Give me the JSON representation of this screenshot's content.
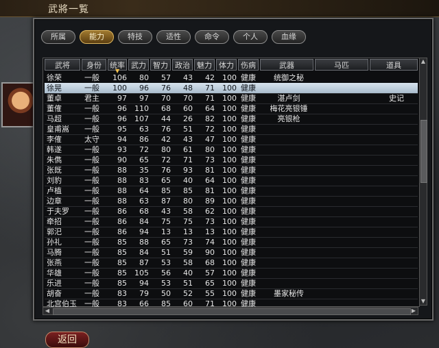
{
  "window_title": "武將一覧",
  "tabs": [
    "所属",
    "能力",
    "特技",
    "适性",
    "命令",
    "个人",
    "血缘"
  ],
  "active_tab": 1,
  "columns": [
    "武将",
    "身份",
    "统率",
    "武力",
    "智力",
    "政治",
    "魅力",
    "体力",
    "伤病",
    "武器",
    "马匹",
    "道具"
  ],
  "sorted_column": 2,
  "selected_row": 1,
  "rows": [
    {
      "name": "徐荣",
      "rank": "一般",
      "lead": 106,
      "war": 80,
      "int": 57,
      "pol": 43,
      "cha": 42,
      "hp": 100,
      "cond": "健康",
      "weapon": "统御之秘",
      "horse": "",
      "item": ""
    },
    {
      "name": "徐晃",
      "rank": "一般",
      "lead": 100,
      "war": 96,
      "int": 76,
      "pol": 48,
      "cha": 71,
      "hp": 100,
      "cond": "健康",
      "weapon": "",
      "horse": "",
      "item": ""
    },
    {
      "name": "董卓",
      "rank": "君主",
      "lead": 97,
      "war": 97,
      "int": 70,
      "pol": 70,
      "cha": 71,
      "hp": 100,
      "cond": "健康",
      "weapon": "湛卢剑",
      "horse": "",
      "item": "史记"
    },
    {
      "name": "董傕",
      "rank": "一般",
      "lead": 96,
      "war": 110,
      "int": 68,
      "pol": 60,
      "cha": 64,
      "hp": 100,
      "cond": "健康",
      "weapon": "梅花亮银锤",
      "horse": "",
      "item": ""
    },
    {
      "name": "马超",
      "rank": "一般",
      "lead": 96,
      "war": 107,
      "int": 44,
      "pol": 26,
      "cha": 82,
      "hp": 100,
      "cond": "健康",
      "weapon": "亮银枪",
      "horse": "",
      "item": ""
    },
    {
      "name": "皇甫嵩",
      "rank": "一般",
      "lead": 95,
      "war": 63,
      "int": 76,
      "pol": 51,
      "cha": 72,
      "hp": 100,
      "cond": "健康",
      "weapon": "",
      "horse": "",
      "item": ""
    },
    {
      "name": "李傕",
      "rank": "太守",
      "lead": 94,
      "war": 86,
      "int": 42,
      "pol": 43,
      "cha": 47,
      "hp": 100,
      "cond": "健康",
      "weapon": "",
      "horse": "",
      "item": ""
    },
    {
      "name": "韩遂",
      "rank": "一般",
      "lead": 93,
      "war": 72,
      "int": 80,
      "pol": 61,
      "cha": 80,
      "hp": 100,
      "cond": "健康",
      "weapon": "",
      "horse": "",
      "item": ""
    },
    {
      "name": "朱儁",
      "rank": "一般",
      "lead": 90,
      "war": 65,
      "int": 72,
      "pol": 71,
      "cha": 73,
      "hp": 100,
      "cond": "健康",
      "weapon": "",
      "horse": "",
      "item": ""
    },
    {
      "name": "张既",
      "rank": "一般",
      "lead": 88,
      "war": 35,
      "int": 76,
      "pol": 93,
      "cha": 81,
      "hp": 100,
      "cond": "健康",
      "weapon": "",
      "horse": "",
      "item": ""
    },
    {
      "name": "刘豹",
      "rank": "一般",
      "lead": 88,
      "war": 83,
      "int": 65,
      "pol": 40,
      "cha": 64,
      "hp": 100,
      "cond": "健康",
      "weapon": "",
      "horse": "",
      "item": ""
    },
    {
      "name": "卢植",
      "rank": "一般",
      "lead": 88,
      "war": 64,
      "int": 85,
      "pol": 85,
      "cha": 81,
      "hp": 100,
      "cond": "健康",
      "weapon": "",
      "horse": "",
      "item": ""
    },
    {
      "name": "边章",
      "rank": "一般",
      "lead": 88,
      "war": 63,
      "int": 87,
      "pol": 80,
      "cha": 89,
      "hp": 100,
      "cond": "健康",
      "weapon": "",
      "horse": "",
      "item": ""
    },
    {
      "name": "于夫罗",
      "rank": "一般",
      "lead": 86,
      "war": 68,
      "int": 43,
      "pol": 58,
      "cha": 62,
      "hp": 100,
      "cond": "健康",
      "weapon": "",
      "horse": "",
      "item": ""
    },
    {
      "name": "牵招",
      "rank": "一般",
      "lead": 86,
      "war": 84,
      "int": 75,
      "pol": 75,
      "cha": 73,
      "hp": 100,
      "cond": "健康",
      "weapon": "",
      "horse": "",
      "item": ""
    },
    {
      "name": "郭汜",
      "rank": "一般",
      "lead": 86,
      "war": 94,
      "int": 13,
      "pol": 13,
      "cha": 13,
      "hp": 100,
      "cond": "健康",
      "weapon": "",
      "horse": "",
      "item": ""
    },
    {
      "name": "孙礼",
      "rank": "一般",
      "lead": 85,
      "war": 88,
      "int": 65,
      "pol": 73,
      "cha": 74,
      "hp": 100,
      "cond": "健康",
      "weapon": "",
      "horse": "",
      "item": ""
    },
    {
      "name": "马腾",
      "rank": "一般",
      "lead": 85,
      "war": 84,
      "int": 51,
      "pol": 59,
      "cha": 90,
      "hp": 100,
      "cond": "健康",
      "weapon": "",
      "horse": "",
      "item": ""
    },
    {
      "name": "张燕",
      "rank": "一般",
      "lead": 85,
      "war": 87,
      "int": 53,
      "pol": 58,
      "cha": 68,
      "hp": 100,
      "cond": "健康",
      "weapon": "",
      "horse": "",
      "item": ""
    },
    {
      "name": "华雄",
      "rank": "一般",
      "lead": 85,
      "war": 105,
      "int": 56,
      "pol": 40,
      "cha": 57,
      "hp": 100,
      "cond": "健康",
      "weapon": "",
      "horse": "",
      "item": ""
    },
    {
      "name": "乐进",
      "rank": "一般",
      "lead": 85,
      "war": 94,
      "int": 53,
      "pol": 51,
      "cha": 65,
      "hp": 100,
      "cond": "健康",
      "weapon": "",
      "horse": "",
      "item": ""
    },
    {
      "name": "胡奋",
      "rank": "一般",
      "lead": 83,
      "war": 79,
      "int": 50,
      "pol": 52,
      "cha": 55,
      "hp": 100,
      "cond": "健康",
      "weapon": "墨家秘传",
      "horse": "",
      "item": ""
    },
    {
      "name": "北宫伯玉",
      "rank": "一般",
      "lead": 83,
      "war": 66,
      "int": 85,
      "pol": 60,
      "cha": 71,
      "hp": 100,
      "cond": "健康",
      "weapon": "",
      "horse": "",
      "item": ""
    }
  ],
  "back_label": "返回"
}
